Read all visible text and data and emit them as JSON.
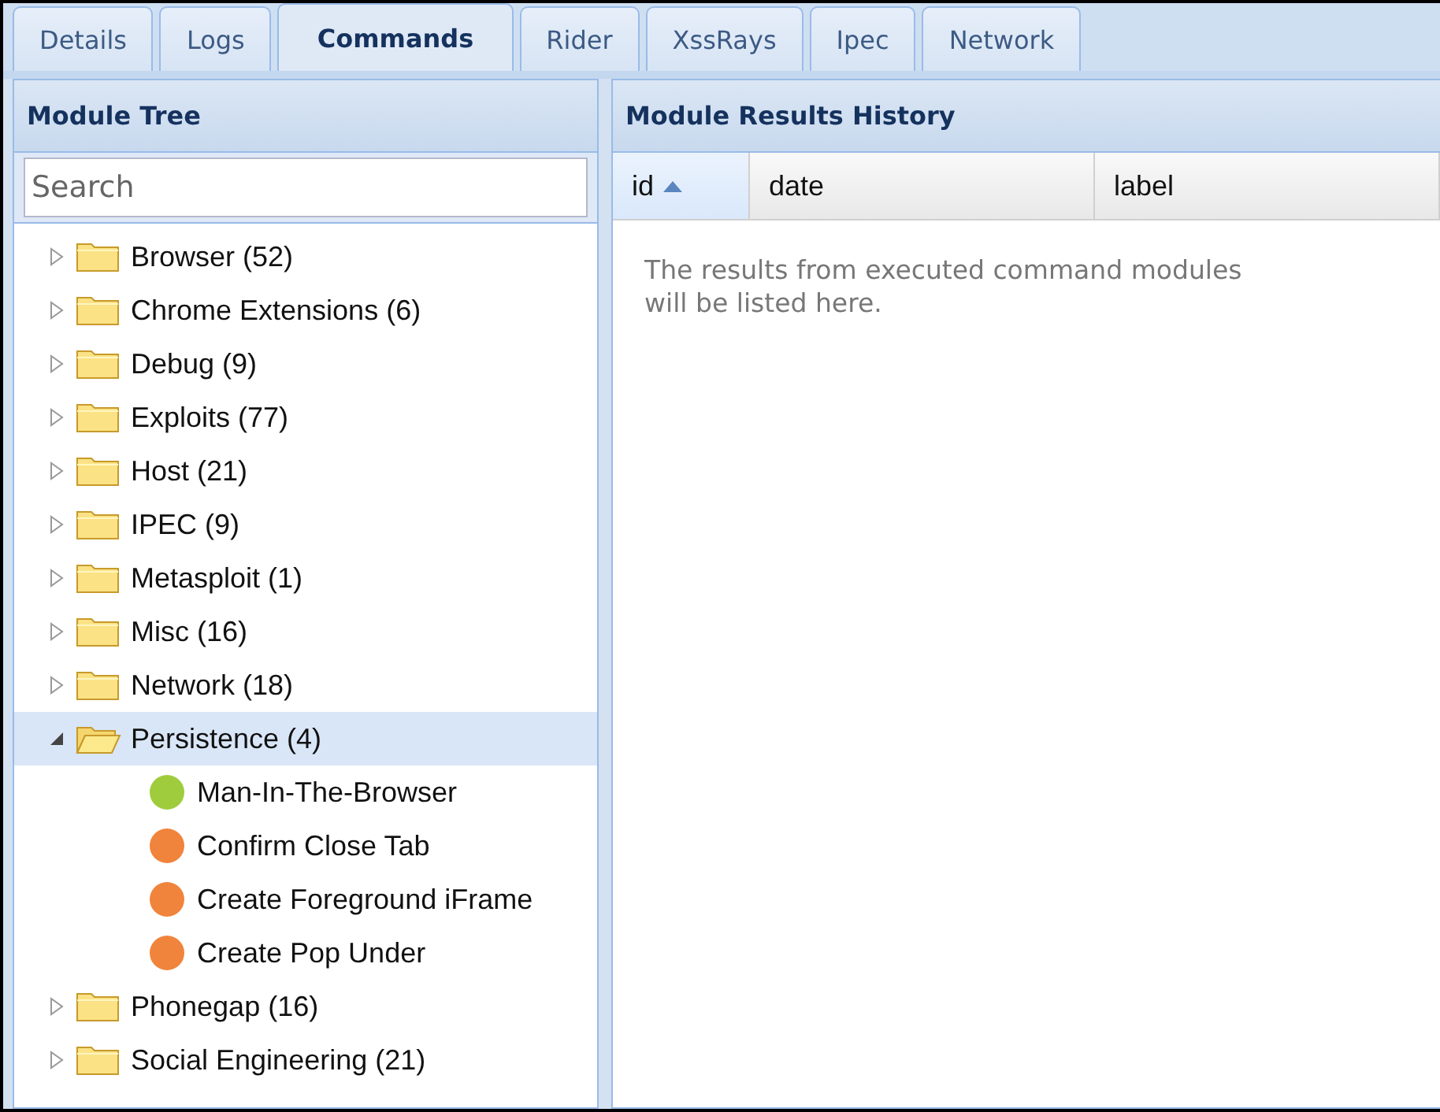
{
  "tabs": [
    {
      "label": "Details",
      "selected": false
    },
    {
      "label": "Logs",
      "selected": false
    },
    {
      "label": "Commands",
      "selected": true
    },
    {
      "label": "Rider",
      "selected": false
    },
    {
      "label": "XssRays",
      "selected": false
    },
    {
      "label": "Ipec",
      "selected": false
    },
    {
      "label": "Network",
      "selected": false
    }
  ],
  "module_tree": {
    "title": "Module Tree",
    "search": {
      "placeholder": "Search"
    },
    "items": [
      {
        "label": "Browser (52)",
        "expanded": false,
        "selected": false
      },
      {
        "label": "Chrome Extensions (6)",
        "expanded": false,
        "selected": false
      },
      {
        "label": "Debug (9)",
        "expanded": false,
        "selected": false
      },
      {
        "label": "Exploits (77)",
        "expanded": false,
        "selected": false
      },
      {
        "label": "Host (21)",
        "expanded": false,
        "selected": false
      },
      {
        "label": "IPEC (9)",
        "expanded": false,
        "selected": false
      },
      {
        "label": "Metasploit (1)",
        "expanded": false,
        "selected": false
      },
      {
        "label": "Misc (16)",
        "expanded": false,
        "selected": false
      },
      {
        "label": "Network (18)",
        "expanded": false,
        "selected": false
      },
      {
        "label": "Persistence (4)",
        "expanded": true,
        "selected": true,
        "children": [
          {
            "label": "Man-In-The-Browser",
            "color": "#9fcc3c"
          },
          {
            "label": "Confirm Close Tab",
            "color": "#f0843c"
          },
          {
            "label": "Create Foreground iFrame",
            "color": "#f0843c"
          },
          {
            "label": "Create Pop Under",
            "color": "#f0843c"
          }
        ]
      },
      {
        "label": "Phonegap (16)",
        "expanded": false,
        "selected": false
      },
      {
        "label": "Social Engineering (21)",
        "expanded": false,
        "selected": false
      }
    ]
  },
  "results": {
    "title": "Module Results History",
    "columns": [
      {
        "label": "id",
        "sorted": true
      },
      {
        "label": "date",
        "sorted": false
      },
      {
        "label": "label",
        "sorted": false
      }
    ],
    "empty_text": "The results from executed command modules will be listed here."
  }
}
